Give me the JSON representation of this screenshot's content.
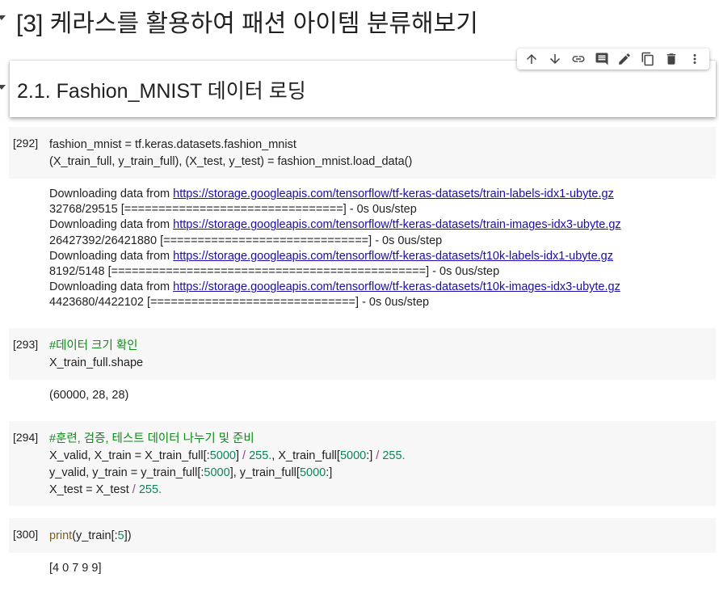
{
  "heading1": {
    "title": "[3] 케라스를 활용하여 패션 아이템 분류해보기"
  },
  "heading2": {
    "title": "2.1. Fashion_MNIST 데이터 로딩"
  },
  "toolbar": {
    "icons": [
      "arrow-up-icon",
      "arrow-down-icon",
      "link-icon",
      "comment-icon",
      "edit-icon",
      "mirror-icon",
      "delete-icon",
      "more-vert-icon"
    ]
  },
  "cells": {
    "c292": {
      "count": "[292]",
      "line1": "fashion_mnist = tf.keras.datasets.fashion_mnist",
      "line2": "(X_train_full, y_train_full), (X_test, y_test) = fashion_mnist.load_data()",
      "output": {
        "prefix": "Downloading data from ",
        "url1": "https://storage.googleapis.com/tensorflow/tf-keras-datasets/train-labels-idx1-ubyte.gz",
        "prog1": "32768/29515 [================================] - 0s 0us/step",
        "url2": "https://storage.googleapis.com/tensorflow/tf-keras-datasets/train-images-idx3-ubyte.gz",
        "prog2": "26427392/26421880 [==============================] - 0s 0us/step",
        "url3": "https://storage.googleapis.com/tensorflow/tf-keras-datasets/t10k-labels-idx1-ubyte.gz",
        "prog3": "8192/5148 [==============================================] - 0s 0us/step",
        "url4": "https://storage.googleapis.com/tensorflow/tf-keras-datasets/t10k-images-idx3-ubyte.gz",
        "prog4": "4423680/4422102 [==============================] - 0s 0us/step"
      }
    },
    "c293": {
      "count": "[293]",
      "comment": "#데이터 크기 확인",
      "line": "X_train_full.shape",
      "output": "(60000, 28, 28)"
    },
    "c294": {
      "count": "[294]",
      "comment": "#훈련, 검증, 테스트 데이터 나누기 및 준비",
      "l1a": "X_valid, X_train = X_train_full[:",
      "n5000a": "5000",
      "l1b": "] ",
      "div": "/",
      "n255a": " 255.",
      "l1c": ", X_train_full[",
      "n5000b": "5000",
      "l1d": ":] ",
      "n255b": " 255.",
      "l2a": "y_valid, y_train = y_train_full[:",
      "n5000c": "5000",
      "l2b": "], y_train_full[",
      "n5000d": "5000",
      "l2c": ":]",
      "l3a": "X_test = X_test ",
      "n255c": " 255."
    },
    "c300": {
      "count": "[300]",
      "fn": "print",
      "a": "(y_train[:",
      "n5": "5",
      "b": "])",
      "output": "[4 0 7 9 9]"
    }
  }
}
